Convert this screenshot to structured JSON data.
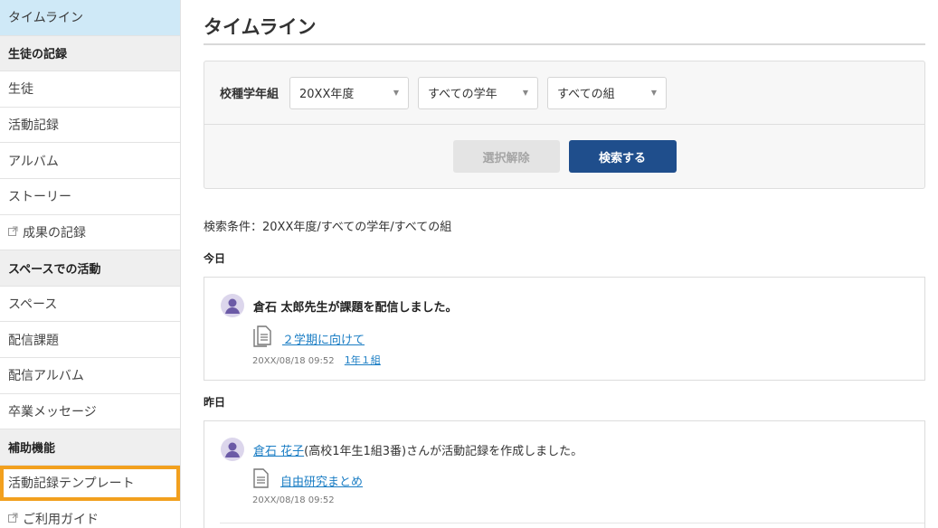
{
  "sidebar": {
    "items": [
      {
        "label": "タイムライン",
        "kind": "active"
      },
      {
        "label": "生徒の記録",
        "kind": "section"
      },
      {
        "label": "生徒",
        "kind": "item"
      },
      {
        "label": "活動記録",
        "kind": "item"
      },
      {
        "label": "アルバム",
        "kind": "item"
      },
      {
        "label": "ストーリー",
        "kind": "item"
      },
      {
        "label": "成果の記録",
        "kind": "external"
      },
      {
        "label": "スペースでの活動",
        "kind": "section"
      },
      {
        "label": "スペース",
        "kind": "item"
      },
      {
        "label": "配信課題",
        "kind": "item"
      },
      {
        "label": "配信アルバム",
        "kind": "item"
      },
      {
        "label": "卒業メッセージ",
        "kind": "item"
      },
      {
        "label": "補助機能",
        "kind": "section"
      },
      {
        "label": "活動記録テンプレート",
        "kind": "highlight"
      },
      {
        "label": "ご利用ガイド",
        "kind": "external"
      }
    ]
  },
  "main": {
    "title": "タイムライン",
    "search": {
      "label": "校種学年組",
      "year_select": "20XX年度",
      "grade_select": "すべての学年",
      "class_select": "すべての組",
      "clear_button": "選択解除",
      "search_button": "検索する"
    },
    "conditions": "検索条件：20XX年度/すべての学年/すべての組",
    "groups": [
      {
        "day": "今日",
        "entry": {
          "message": "倉石 太郎先生が課題を配信しました。",
          "item_link": "２学期に向けて",
          "timestamp": "20XX/08/18 09:52",
          "class_link": "1年１組"
        }
      },
      {
        "day": "昨日",
        "entry": {
          "student_link": "倉石 花子",
          "message": "(高校1年生1組3番)さんが活動記録を作成しました。",
          "item_link": "自由研究まとめ",
          "timestamp": "20XX/08/18 09:52"
        }
      }
    ]
  },
  "colors": {
    "accent": "#1f4e8c",
    "active_bg": "#cfe9f7",
    "highlight": "#f2a01e",
    "link": "#1a7dc4"
  }
}
